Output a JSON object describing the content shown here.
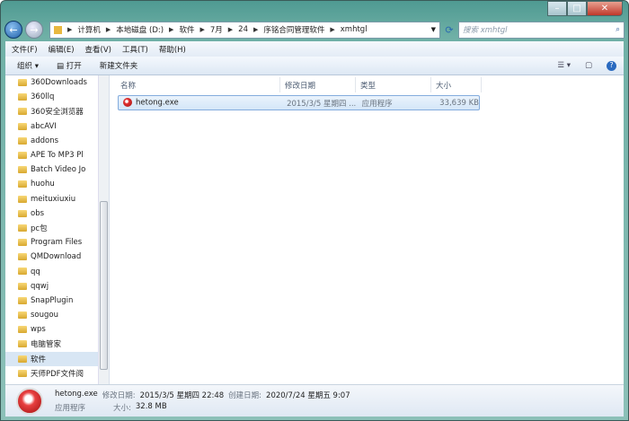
{
  "breadcrumb": [
    "计算机",
    "本地磁盘 (D:)",
    "软件",
    "7月",
    "24",
    "序铭合同管理软件",
    "xmhtgl"
  ],
  "search": {
    "placeholder": "搜索 xmhtgl"
  },
  "menu": [
    "文件(F)",
    "编辑(E)",
    "查看(V)",
    "工具(T)",
    "帮助(H)"
  ],
  "toolbar": {
    "organize": "组织 ▾",
    "open": "打开",
    "new_folder": "新建文件夹"
  },
  "sidebar": [
    "360Downloads",
    "360llq",
    "360安全浏览器",
    "abcAVI",
    "addons",
    "APE To MP3 Pl",
    "Batch Video Jo",
    "huohu",
    "meituxiuxiu",
    "obs",
    "pc包",
    "Program Files",
    "QMDownload",
    "qq",
    "qqwj",
    "SnapPlugin",
    "sougou",
    "wps",
    "电脑管家",
    "软件",
    "天师PDF文件阅"
  ],
  "sidebar_selected": "软件",
  "columns": {
    "name": "名称",
    "modified": "修改日期",
    "type": "类型",
    "size": "大小"
  },
  "files": [
    {
      "name": "hetong.exe",
      "modified": "2015/3/5 星期四 ...",
      "type": "应用程序",
      "size": "33,639 KB"
    }
  ],
  "details": {
    "name": "hetong.exe",
    "modified_label": "修改日期:",
    "modified": "2015/3/5 星期四 22:48",
    "created_label": "创建日期:",
    "created": "2020/7/24 星期五 9:07",
    "type": "应用程序",
    "size_label": "大小:",
    "size": "32.8 MB"
  }
}
